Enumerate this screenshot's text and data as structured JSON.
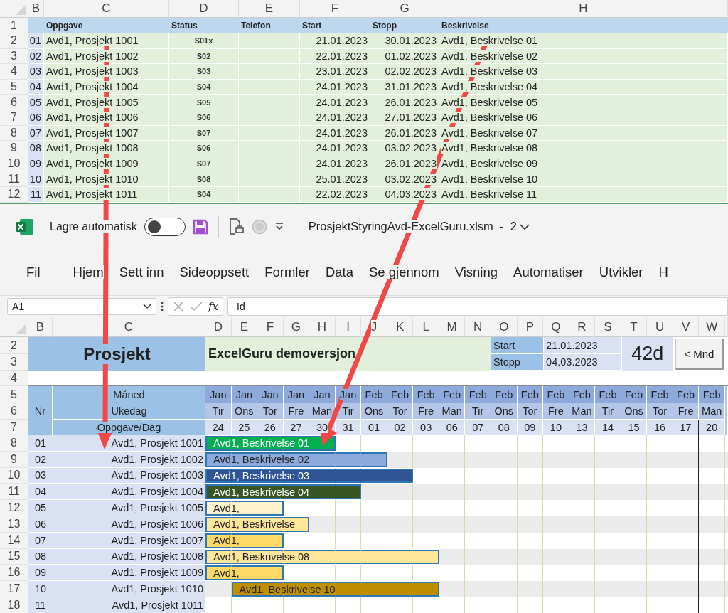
{
  "top_sheet": {
    "column_letters": [
      "B",
      "C",
      "D",
      "E",
      "F",
      "G",
      "H"
    ],
    "row_numbers": [
      "1",
      "2",
      "3",
      "4",
      "5",
      "6",
      "7",
      "8",
      "9",
      "10",
      "11",
      "12"
    ],
    "headers": [
      "Oppgave",
      "Status",
      "Telefon",
      "Start",
      "Stopp",
      "Beskrivelse"
    ],
    "rows": [
      {
        "nr": "01",
        "task": "Avd1, Prosjekt 1001",
        "status": "S01x",
        "start": "21.01.2023",
        "stop": "30.01.2023",
        "description": "Avd1, Beskrivelse 01"
      },
      {
        "nr": "02",
        "task": "Avd1, Prosjekt 1002",
        "status": "S02",
        "start": "22.01.2023",
        "stop": "01.02.2023",
        "description": "Avd1, Beskrivelse 02"
      },
      {
        "nr": "03",
        "task": "Avd1, Prosjekt 1003",
        "status": "S03",
        "start": "23.01.2023",
        "stop": "02.02.2023",
        "description": "Avd1, Beskrivelse 03"
      },
      {
        "nr": "04",
        "task": "Avd1, Prosjekt 1004",
        "status": "S04",
        "start": "24.01.2023",
        "stop": "31.01.2023",
        "description": "Avd1, Beskrivelse 04"
      },
      {
        "nr": "05",
        "task": "Avd1, Prosjekt 1005",
        "status": "S05",
        "start": "24.01.2023",
        "stop": "26.01.2023",
        "description": "Avd1, Beskrivelse 05"
      },
      {
        "nr": "06",
        "task": "Avd1, Prosjekt 1006",
        "status": "S06",
        "start": "24.01.2023",
        "stop": "27.01.2023",
        "description": "Avd1, Beskrivelse 06"
      },
      {
        "nr": "07",
        "task": "Avd1, Prosjekt 1007",
        "status": "S07",
        "start": "24.01.2023",
        "stop": "26.01.2023",
        "description": "Avd1, Beskrivelse 07"
      },
      {
        "nr": "08",
        "task": "Avd1, Prosjekt 1008",
        "status": "S06",
        "start": "24.01.2023",
        "stop": "03.02.2023",
        "description": "Avd1, Beskrivelse 08"
      },
      {
        "nr": "09",
        "task": "Avd1, Prosjekt 1009",
        "status": "S07",
        "start": "24.01.2023",
        "stop": "26.01.2023",
        "description": "Avd1, Beskrivelse 09"
      },
      {
        "nr": "10",
        "task": "Avd1, Prosjekt 1010",
        "status": "S08",
        "start": "25.01.2023",
        "stop": "03.02.2023",
        "description": "Avd1, Beskrivelse 10"
      },
      {
        "nr": "11",
        "task": "Avd1, Prosjekt 1011",
        "status": "S04",
        "start": "22.02.2023",
        "stop": "04.03.2023",
        "description": "Avd1, Beskrivelse 11"
      }
    ]
  },
  "excel_window": {
    "title_bar": {
      "autosave_label": "Lagre automatisk",
      "autosave_on": false,
      "file_title": "ProsjektStyringAvd-ExcelGuru.xlsm  -  2"
    },
    "ribbon_tabs": [
      "Fil",
      "Hjem",
      "Sett inn",
      "Sideoppsett",
      "Formler",
      "Data",
      "Se gjennom",
      "Visning",
      "Automatiser",
      "Utvikler",
      "H"
    ],
    "formula_bar": {
      "name_box": "A1",
      "function_label": "fx",
      "formula": "Id"
    }
  },
  "gantt_sheet": {
    "column_letters": [
      "B",
      "C",
      "D",
      "E",
      "F",
      "G",
      "H",
      "I",
      "J",
      "K",
      "L",
      "M",
      "N",
      "O",
      "P",
      "Q",
      "R",
      "S",
      "T",
      "U",
      "V",
      "W"
    ],
    "row_numbers": [
      "2",
      "3",
      "4",
      "5",
      "6",
      "7",
      "8",
      "9",
      "10",
      "11",
      "12",
      "13",
      "14",
      "15",
      "16",
      "17",
      "18"
    ],
    "project_heading": "Prosjekt",
    "subtitle": "ExcelGuru demoversjon",
    "start_label": "Start",
    "start_value": "21.01.2023",
    "stop_label": "Stopp",
    "stop_value": "04.03.2023",
    "duration": "42d",
    "month_button": "< Mnd",
    "header_labels": {
      "nr": "Nr",
      "month": "Måned",
      "weekday": "Ukedag",
      "task_day": "Oppgave/Dag"
    },
    "days": [
      {
        "month": "Jan",
        "weekday": "Tir",
        "day": "24",
        "week_end": false
      },
      {
        "month": "Jan",
        "weekday": "Ons",
        "day": "25",
        "week_end": false
      },
      {
        "month": "Jan",
        "weekday": "Tor",
        "day": "26",
        "week_end": false
      },
      {
        "month": "Jan",
        "weekday": "Fre",
        "day": "27",
        "week_end": true
      },
      {
        "month": "Jan",
        "weekday": "Man",
        "day": "30",
        "week_end": false
      },
      {
        "month": "Jan",
        "weekday": "Tir",
        "day": "31",
        "week_end": false
      },
      {
        "month": "Feb",
        "weekday": "Ons",
        "day": "01",
        "week_end": false
      },
      {
        "month": "Feb",
        "weekday": "Tor",
        "day": "02",
        "week_end": false
      },
      {
        "month": "Feb",
        "weekday": "Fre",
        "day": "03",
        "week_end": true
      },
      {
        "month": "Feb",
        "weekday": "Man",
        "day": "06",
        "week_end": false
      },
      {
        "month": "Feb",
        "weekday": "Tir",
        "day": "07",
        "week_end": false
      },
      {
        "month": "Feb",
        "weekday": "Ons",
        "day": "08",
        "week_end": false
      },
      {
        "month": "Feb",
        "weekday": "Tor",
        "day": "09",
        "week_end": false
      },
      {
        "month": "Feb",
        "weekday": "Fre",
        "day": "10",
        "week_end": true
      },
      {
        "month": "Feb",
        "weekday": "Man",
        "day": "13",
        "week_end": false
      },
      {
        "month": "Feb",
        "weekday": "Tir",
        "day": "14",
        "week_end": false
      },
      {
        "month": "Feb",
        "weekday": "Ons",
        "day": "15",
        "week_end": false
      },
      {
        "month": "Feb",
        "weekday": "Tor",
        "day": "16",
        "week_end": false
      },
      {
        "month": "Feb",
        "weekday": "Fre",
        "day": "17",
        "week_end": true
      },
      {
        "month": "Feb",
        "weekday": "Man",
        "day": "20",
        "week_end": false
      }
    ],
    "tasks": [
      {
        "nr": "01",
        "project": "Avd1, Prosjekt 1001",
        "bar_label": "Avd1, Beskrivelse 01",
        "color": "#00b050",
        "scheduled": [
          true,
          true,
          true,
          true,
          true,
          false,
          false,
          false,
          false,
          false,
          false,
          false,
          false,
          false,
          false,
          false,
          false,
          false,
          false,
          false
        ]
      },
      {
        "nr": "02",
        "project": "Avd1, Prosjekt 1002",
        "bar_label": "Avd1, Beskrivelse 02",
        "color": "#8ea9db",
        "scheduled": [
          true,
          true,
          true,
          true,
          true,
          true,
          true,
          false,
          false,
          false,
          false,
          false,
          false,
          false,
          false,
          false,
          false,
          false,
          false,
          false
        ]
      },
      {
        "nr": "03",
        "project": "Avd1, Prosjekt 1003",
        "bar_label": "Avd1, Beskrivelse 03",
        "color": "#2f5597",
        "scheduled": [
          true,
          true,
          true,
          true,
          true,
          true,
          true,
          true,
          false,
          false,
          false,
          false,
          false,
          false,
          false,
          false,
          false,
          false,
          false,
          false
        ]
      },
      {
        "nr": "04",
        "project": "Avd1, Prosjekt 1004",
        "bar_label": "Avd1, Beskrivelse 04",
        "color": "#375623",
        "scheduled": [
          true,
          true,
          true,
          true,
          true,
          true,
          false,
          false,
          false,
          false,
          false,
          false,
          false,
          false,
          false,
          false,
          false,
          false,
          false,
          false
        ]
      },
      {
        "nr": "05",
        "project": "Avd1, Prosjekt 1005",
        "bar_label": "Avd1,",
        "color": "#fff2cc",
        "scheduled": [
          true,
          true,
          true,
          false,
          false,
          false,
          false,
          false,
          false,
          false,
          false,
          false,
          false,
          false,
          false,
          false,
          false,
          false,
          false,
          false
        ]
      },
      {
        "nr": "06",
        "project": "Avd1, Prosjekt 1006",
        "bar_label": "Avd1, Beskrivelse",
        "color": "#ffe699",
        "scheduled": [
          true,
          true,
          true,
          true,
          false,
          false,
          false,
          false,
          false,
          false,
          false,
          false,
          false,
          false,
          false,
          false,
          false,
          false,
          false,
          false
        ]
      },
      {
        "nr": "07",
        "project": "Avd1, Prosjekt 1007",
        "bar_label": "Avd1,",
        "color": "#ffd966",
        "scheduled": [
          true,
          true,
          true,
          false,
          false,
          false,
          false,
          false,
          false,
          false,
          false,
          false,
          false,
          false,
          false,
          false,
          false,
          false,
          false,
          false
        ]
      },
      {
        "nr": "08",
        "project": "Avd1, Prosjekt 1008",
        "bar_label": "Avd1, Beskrivelse 08",
        "color": "#ffe699",
        "scheduled": [
          true,
          true,
          true,
          true,
          true,
          true,
          true,
          true,
          true,
          false,
          false,
          false,
          false,
          false,
          false,
          false,
          false,
          false,
          false,
          false
        ]
      },
      {
        "nr": "09",
        "project": "Avd1, Prosjekt 1009",
        "bar_label": "Avd1,",
        "color": "#ffd966",
        "scheduled": [
          true,
          true,
          true,
          false,
          false,
          false,
          false,
          false,
          false,
          false,
          false,
          false,
          false,
          false,
          false,
          false,
          false,
          false,
          false,
          false
        ]
      },
      {
        "nr": "10",
        "project": "Avd1, Prosjekt 1010",
        "bar_label": "Avd1, Beskrivelse 10",
        "color": "#bf8f00",
        "scheduled": [
          false,
          true,
          true,
          true,
          true,
          true,
          true,
          true,
          true,
          false,
          false,
          false,
          false,
          false,
          false,
          false,
          false,
          false,
          false,
          false
        ]
      },
      {
        "nr": "11",
        "project": "Avd1, Prosjekt 1011",
        "scheduled": [
          false,
          false,
          false,
          false,
          false,
          false,
          false,
          false,
          false,
          false,
          false,
          false,
          false,
          false,
          false,
          false,
          false,
          false,
          false,
          false
        ]
      }
    ]
  }
}
